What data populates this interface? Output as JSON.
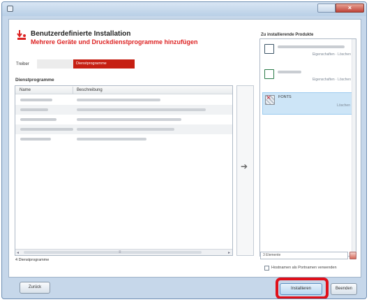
{
  "window": {
    "title": "",
    "close_glyph": "×"
  },
  "header": {
    "title": "Benutzerdefinierte Installation",
    "subtitle": "Mehrere Geräte und Druckdienstprogramme hinzufügen"
  },
  "filter": {
    "treiber_label": "Treiber",
    "active_tab": "Dienstprogramme"
  },
  "utilities": {
    "section_label": "Dienstprogramme",
    "columns": [
      "Name",
      "Beschreibung"
    ],
    "rows": [
      {},
      {},
      {},
      {},
      {}
    ],
    "count_label": "4 Dienstprogramme",
    "scroll_left": "◂",
    "scroll_right": "▸",
    "scroll_grip": "≡"
  },
  "transfer": {
    "arrow": "➔"
  },
  "products": {
    "title": "Zu installierende Produkte",
    "items": [
      {
        "name": "",
        "icon": "printer-icon",
        "actions": "Eigenschaften · Löschen",
        "selected": false
      },
      {
        "name": "",
        "icon": "utility-icon",
        "actions": "Eigenschaften · Löschen",
        "selected": false
      },
      {
        "name": "FONTS",
        "icon": "fonts-icon",
        "actions": "Löschen",
        "selected": true
      }
    ],
    "count_text": "3 Elemente",
    "checkbox_label": "Hostnamen als Portnamen verwenden"
  },
  "buttons": {
    "back": "Zurück",
    "install": "Installieren",
    "cancel": "Beenden"
  },
  "colors": {
    "accent_red": "#c61f12",
    "selection_blue": "#cde5f7",
    "highlight_ring": "#e0101a"
  }
}
